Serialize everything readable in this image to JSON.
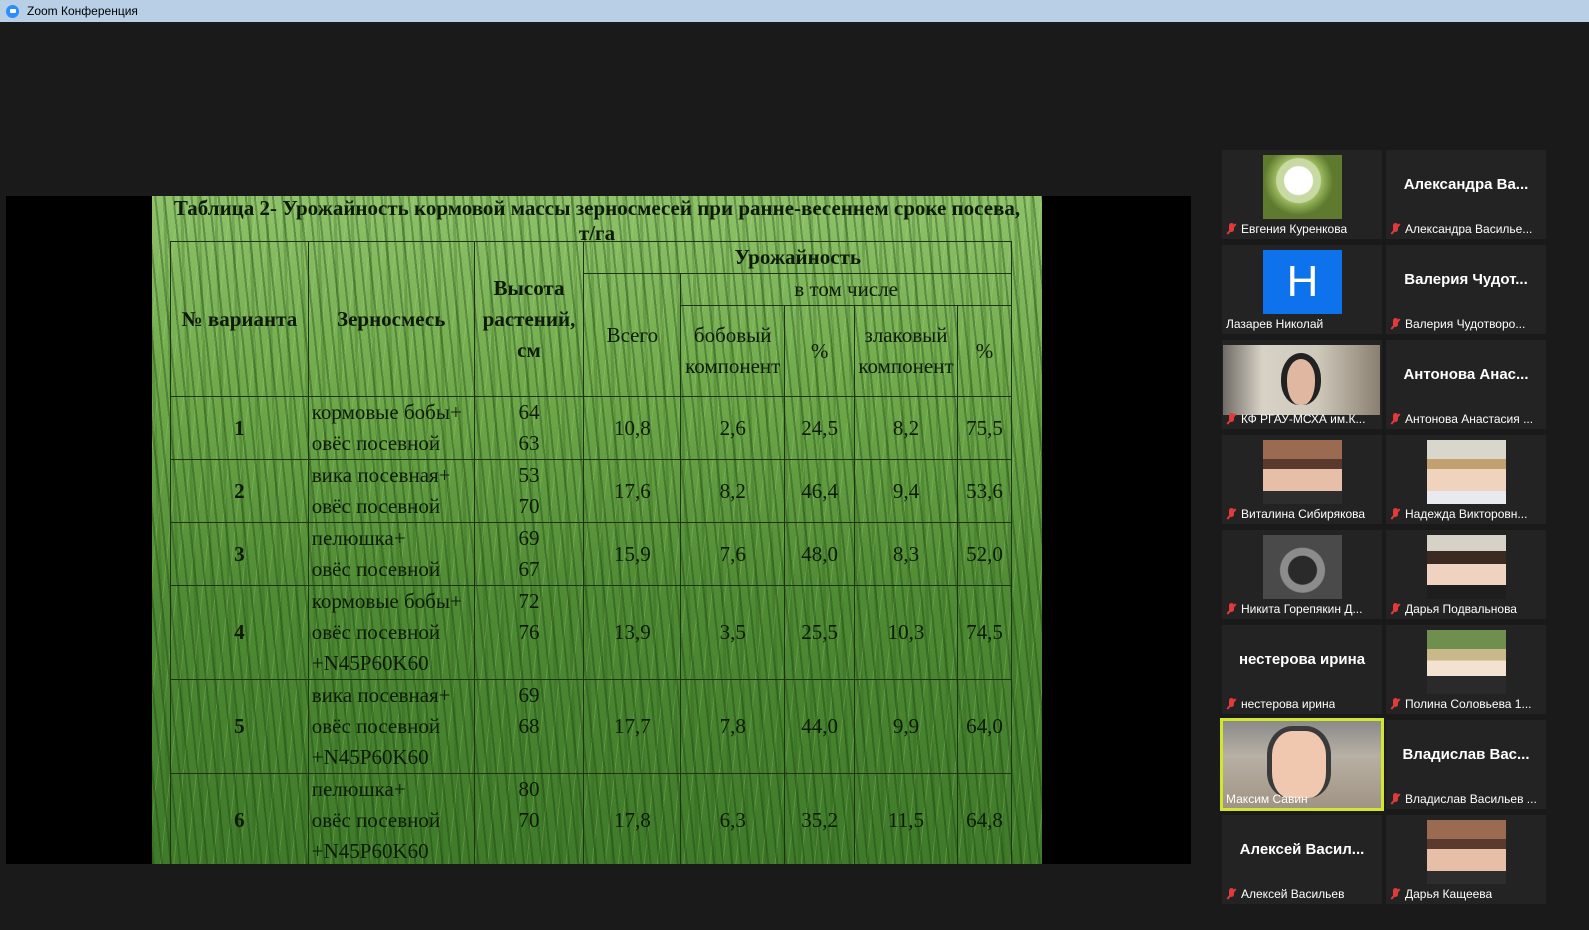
{
  "window": {
    "title": "Zoom Конференция"
  },
  "slide": {
    "title": "Таблица 2- Урожайность кормовой массы зерносмесей при ранне-весеннем сроке посева, т/га",
    "headers": {
      "variant": "№ варианта",
      "mix": "Зерносмесь",
      "height": "Высота растений, см",
      "yield": "Урожайность",
      "total": "Всего",
      "including": "в том числе",
      "legume": "бобовый компонент",
      "pct1": "%",
      "cereal": "злаковый компонент",
      "pct2": "%"
    },
    "rows": [
      {
        "no": "1",
        "mix": [
          "кормовые бобы+",
          "овёс посевной"
        ],
        "height": [
          "64",
          "63"
        ],
        "total": "10,8",
        "legume": "2,6",
        "legume_pct": "24,5",
        "cereal": "8,2",
        "cereal_pct": "75,5"
      },
      {
        "no": "2",
        "mix": [
          "вика посевная+",
          "овёс посевной"
        ],
        "height": [
          "53",
          "70"
        ],
        "total": "17,6",
        "legume": "8,2",
        "legume_pct": "46,4",
        "cereal": "9,4",
        "cereal_pct": "53,6"
      },
      {
        "no": "3",
        "mix": [
          "пелюшка+",
          "овёс посевной"
        ],
        "height": [
          "69",
          "67"
        ],
        "total": "15,9",
        "legume": "7,6",
        "legume_pct": "48,0",
        "cereal": "8,3",
        "cereal_pct": "52,0"
      },
      {
        "no": "4",
        "mix": [
          "кормовые бобы+",
          "овёс посевной",
          "+N45P60K60"
        ],
        "height": [
          "72",
          "76"
        ],
        "total": "13,9",
        "legume": "3,5",
        "legume_pct": "25,5",
        "cereal": "10,3",
        "cereal_pct": "74,5"
      },
      {
        "no": "5",
        "mix": [
          "вика посевная+",
          "овёс посевной",
          "+N45P60K60"
        ],
        "height": [
          "69",
          "68"
        ],
        "total": "17,7",
        "legume": "7,8",
        "legume_pct": "44,0",
        "cereal": "9,9",
        "cereal_pct": "64,0"
      },
      {
        "no": "6",
        "mix": [
          "пелюшка+",
          "овёс посевной",
          "+N45P60K60"
        ],
        "height": [
          "80",
          "70"
        ],
        "total": "17,8",
        "legume": "6,3",
        "legume_pct": "35,2",
        "cereal": "11,5",
        "cereal_pct": "64,8"
      }
    ]
  },
  "participants": [
    {
      "name": "Евгения Куренкова",
      "avatar": "flower"
    },
    {
      "name": "Александра Васильева",
      "big": "Александра Ва...",
      "label": "Александра Василье..."
    },
    {
      "name": "Лазарев Николай",
      "avatar": "initial",
      "initial": "Н"
    },
    {
      "name": "Валерия Чудотворова",
      "big": "Валерия Чудот...",
      "label": "Валерия Чудотворо..."
    },
    {
      "name": "КФ РГАУ-МСХА им.К...",
      "avatar": "video"
    },
    {
      "name": "Антонова Анастасия",
      "big": "Антонова Анас...",
      "label": "Антонова Анастасия ..."
    },
    {
      "name": "Виталина Сибирякова",
      "avatar": "photo"
    },
    {
      "name": "Надежда Викторовна",
      "avatar": "photo",
      "label": "Надежда Викторовн..."
    },
    {
      "name": "Никита Горепякин Д...",
      "avatar": "photo"
    },
    {
      "name": "Дарья Подвальнова",
      "avatar": "photo"
    },
    {
      "name": "нестерова ирина",
      "big": "нестерова ирина",
      "label": "нестерова ирина"
    },
    {
      "name": "Полина Соловьева 1...",
      "avatar": "photo"
    },
    {
      "name": "Максим Савин",
      "avatar": "camera",
      "active": true
    },
    {
      "name": "Владислав Васильев",
      "big": "Владислав Вас...",
      "label": "Владислав Васильев ..."
    },
    {
      "name": "Алексей Васильев",
      "big": "Алексей Васил...",
      "label": "Алексей Васильев"
    },
    {
      "name": "Дарья Кащеева",
      "avatar": "photo"
    }
  ]
}
